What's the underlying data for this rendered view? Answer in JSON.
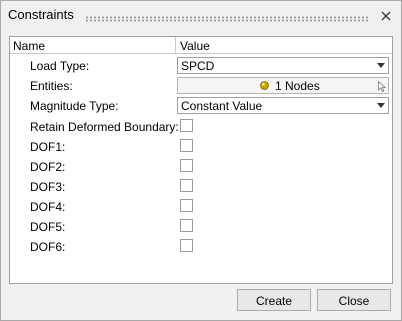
{
  "dialog": {
    "title": "Constraints"
  },
  "table": {
    "header_name": "Name",
    "header_value": "Value"
  },
  "rows": {
    "load_type": {
      "label": "Load Type:",
      "value": "SPCD"
    },
    "entities": {
      "label": "Entities:",
      "value": "1 Nodes"
    },
    "magnitude_type": {
      "label": "Magnitude Type:",
      "value": "Constant Value"
    },
    "retain_deformed_boundary": {
      "label": "Retain Deformed Boundary:"
    },
    "dof1": {
      "label": "DOF1:"
    },
    "dof2": {
      "label": "DOF2:"
    },
    "dof3": {
      "label": "DOF3:"
    },
    "dof4": {
      "label": "DOF4:"
    },
    "dof5": {
      "label": "DOF5:"
    },
    "dof6": {
      "label": "DOF6:"
    }
  },
  "checkboxes": {
    "retain_deformed_boundary": false,
    "dof1": false,
    "dof2": false,
    "dof3": false,
    "dof4": false,
    "dof5": false,
    "dof6": false
  },
  "buttons": {
    "create": "Create",
    "close": "Close"
  },
  "colors": {
    "dialog_bg": "#f0f0f0",
    "panel_bg": "#ffffff",
    "entity_ball": "#c8a400"
  }
}
